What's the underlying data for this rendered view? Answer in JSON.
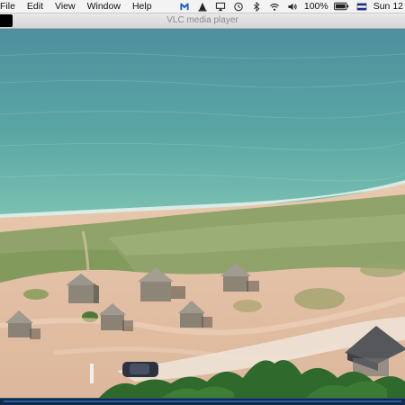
{
  "menubar": {
    "items": [
      "File",
      "Edit",
      "View",
      "Window",
      "Help"
    ],
    "status": {
      "battery_percent": "100%",
      "clock": "Sun 12"
    },
    "icons": [
      "malwarebytes-icon",
      "vlc-cone-icon",
      "airplay-icon",
      "time-machine-icon",
      "bluetooth-icon",
      "wifi-icon",
      "volume-icon",
      "battery-icon",
      "flag-icon"
    ]
  },
  "window": {
    "title": "VLC media player"
  },
  "video": {
    "description_colors": {
      "sea": "#5aa7a4",
      "sand": "#e6c3a7",
      "grass": "#8fa36a",
      "trees": "#2f6a2c"
    }
  }
}
